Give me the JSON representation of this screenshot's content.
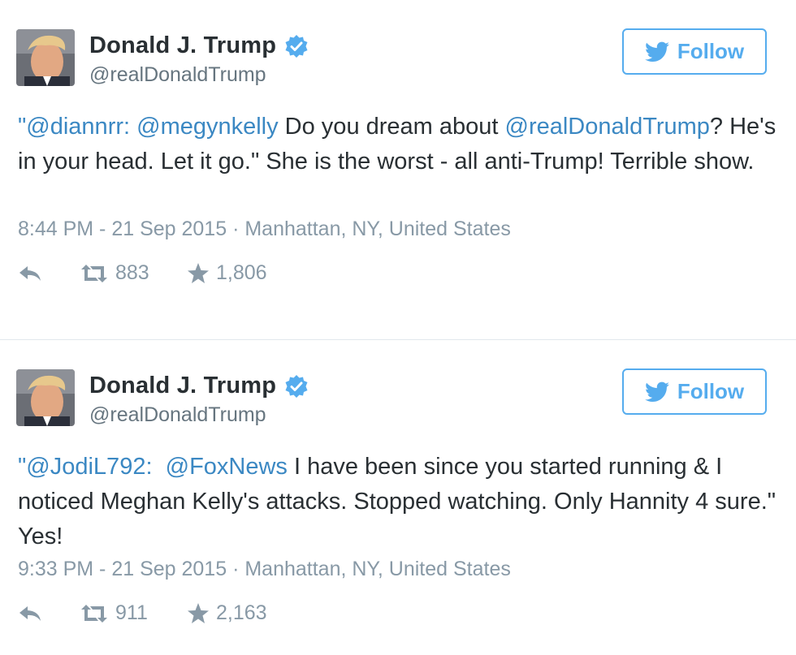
{
  "tweets": [
    {
      "author": {
        "name": "Donald J. Trump",
        "handle": "@realDonaldTrump"
      },
      "follow_label": "Follow",
      "text": {
        "m1": "\"@diannrr:",
        "s1": " ",
        "m2": "@megynkelly",
        "t1": " Do you dream about ",
        "m3": "@realDonaldTrump",
        "t2": "? He's in your head. Let it go.\" She is the worst - all anti-Trump! Terrible show."
      },
      "meta": "8:44 PM - 21 Sep 2015 · Manhattan, NY, United States",
      "retweets": "883",
      "favorites": "1,806"
    },
    {
      "author": {
        "name": "Donald J. Trump",
        "handle": "@realDonaldTrump"
      },
      "follow_label": "Follow",
      "text": {
        "m1": "\"@JodiL792:",
        "s1": "  ",
        "m2": "@FoxNews",
        "t1": " I have been since you started running & I noticed Meghan Kelly's attacks. Stopped watching. Only Hannity 4 sure.\" Yes!"
      },
      "meta": "9:33 PM - 21 Sep 2015 · Manhattan, NY, United States",
      "retweets": "911",
      "favorites": "2,163"
    }
  ],
  "icons": {
    "verified": "verified-badge-icon",
    "follow": "twitter-bird-icon",
    "reply": "reply-icon",
    "retweet": "retweet-icon",
    "favorite": "star-icon"
  },
  "colors": {
    "accent": "#55acee",
    "link": "#3b88c3",
    "meta": "#8899a6",
    "text": "#292f33"
  }
}
